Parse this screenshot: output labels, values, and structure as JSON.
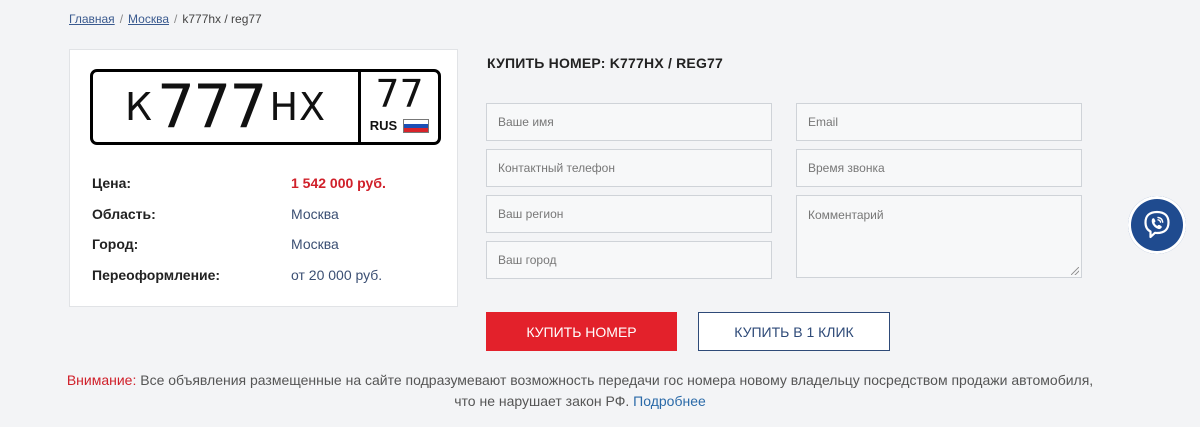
{
  "breadcrumb": {
    "items": [
      "Главная",
      "Москва"
    ],
    "current": "k777hx / reg77"
  },
  "plate": {
    "letter1": "К",
    "digits": "777",
    "letters2": "НХ",
    "region": "77",
    "country": "RUS"
  },
  "info": {
    "rows": [
      {
        "label": "Цена:",
        "value": "1 542 000 руб."
      },
      {
        "label": "Область:",
        "value": "Москва"
      },
      {
        "label": "Город:",
        "value": "Москва"
      },
      {
        "label": "Переоформление:",
        "value": "от 20 000 руб."
      }
    ]
  },
  "form": {
    "title": "КУПИТЬ НОМЕР: K777HX / REG77",
    "name_placeholder": "Ваше имя",
    "email_placeholder": "Email",
    "phone_placeholder": "Контактный телефон",
    "call_time_placeholder": "Время звонка",
    "region_placeholder": "Ваш регион",
    "comment_placeholder": "Комментарий",
    "city_placeholder": "Ваш город",
    "buy_button": "КУПИТЬ НОМЕР",
    "one_click_button": "КУПИТЬ В 1 КЛИК"
  },
  "notice": {
    "warning": "Внимание:",
    "text": " Все объявления размещенные на сайте подразумевают возможность передачи гос номера новому владельцу посредством продажи автомобиля, что не нарушает закон РФ.",
    "link": "Подробнее"
  },
  "colors": {
    "accent_red": "#e3212b",
    "navy": "#2e4a78",
    "viber_bg": "#1f4b8f"
  },
  "icons": {
    "contact": "viber-icon"
  }
}
